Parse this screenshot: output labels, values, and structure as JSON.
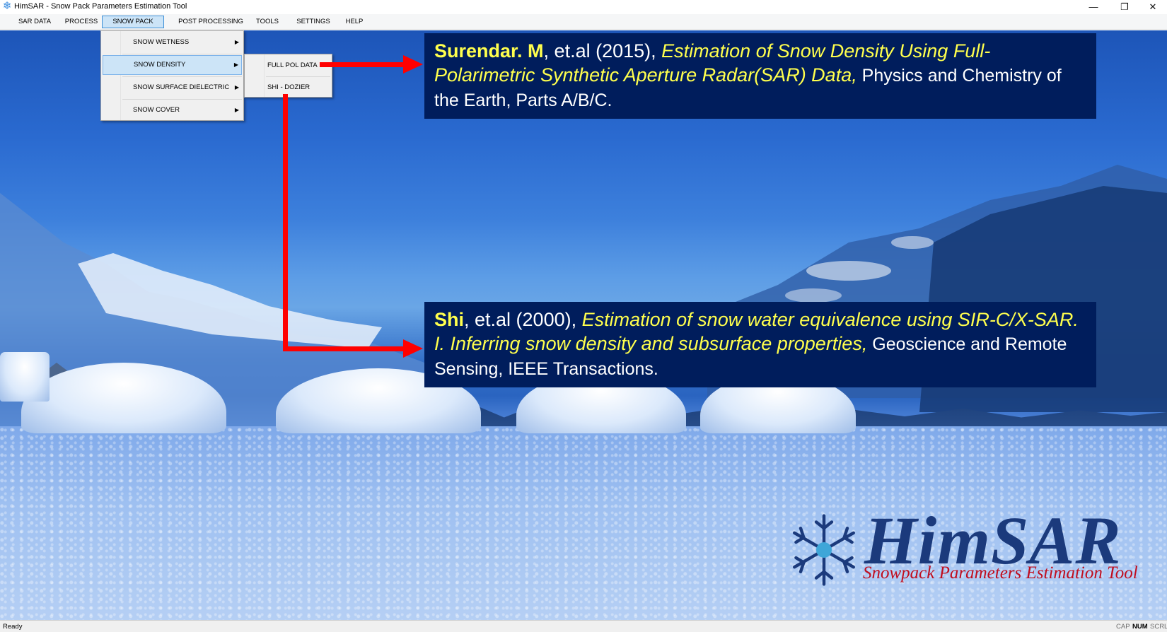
{
  "window": {
    "title": "HimSAR - Snow Pack Parameters Estimation Tool",
    "minimize": "—",
    "restore": "❐",
    "close": "✕"
  },
  "menubar": {
    "items": [
      {
        "label": "SAR DATA"
      },
      {
        "label": "PROCESS"
      },
      {
        "label": "SNOW PACK"
      },
      {
        "label": "POST PROCESSING"
      },
      {
        "label": "TOOLS"
      },
      {
        "label": "SETTINGS"
      },
      {
        "label": "HELP"
      }
    ],
    "active": "SNOW PACK"
  },
  "snow_pack_menu": {
    "items": [
      {
        "label": "SNOW WETNESS"
      },
      {
        "label": "SNOW DENSITY"
      },
      {
        "label": "SNOW SURFACE DIELECTRIC"
      },
      {
        "label": "SNOW COVER"
      }
    ],
    "highlighted": "SNOW DENSITY"
  },
  "snow_density_menu": {
    "items": [
      {
        "label": "FULL POL DATA"
      },
      {
        "label": "SHI - DOZIER"
      }
    ]
  },
  "references": [
    {
      "author": "Surendar. M",
      "year": ", et.al (2015), ",
      "title": "Estimation of Snow Density Using Full-Polarimetric Synthetic Aperture Radar(SAR) Data,",
      "journal": " Physics and Chemistry of the Earth, Parts A/B/C."
    },
    {
      "author": "Shi",
      "year": ", et.al (2000), ",
      "title": "Estimation of snow water equivalence using SIR-C/X-SAR. I. Inferring snow density and subsurface properties,",
      "journal": " Geoscience and Remote Sensing, IEEE Transactions."
    }
  ],
  "logo": {
    "name": "HimSAR",
    "tagline": "Snowpack Parameters Estimation Tool"
  },
  "statusbar": {
    "status": "Ready",
    "indicators": [
      {
        "label": "CAP",
        "on": false
      },
      {
        "label": "NUM",
        "on": true
      },
      {
        "label": "SCRL",
        "on": false
      }
    ]
  },
  "colors": {
    "accent": "#cce4f7",
    "reference_bg": "#001d5c",
    "highlight_text": "#ffff4d",
    "arrow": "#ff0000",
    "logo_blue": "#1b3a7c",
    "logo_red": "#c00d1e"
  },
  "icons": {
    "app": "snowflake-icon",
    "submenu_arrow": "triangle-right-icon"
  }
}
